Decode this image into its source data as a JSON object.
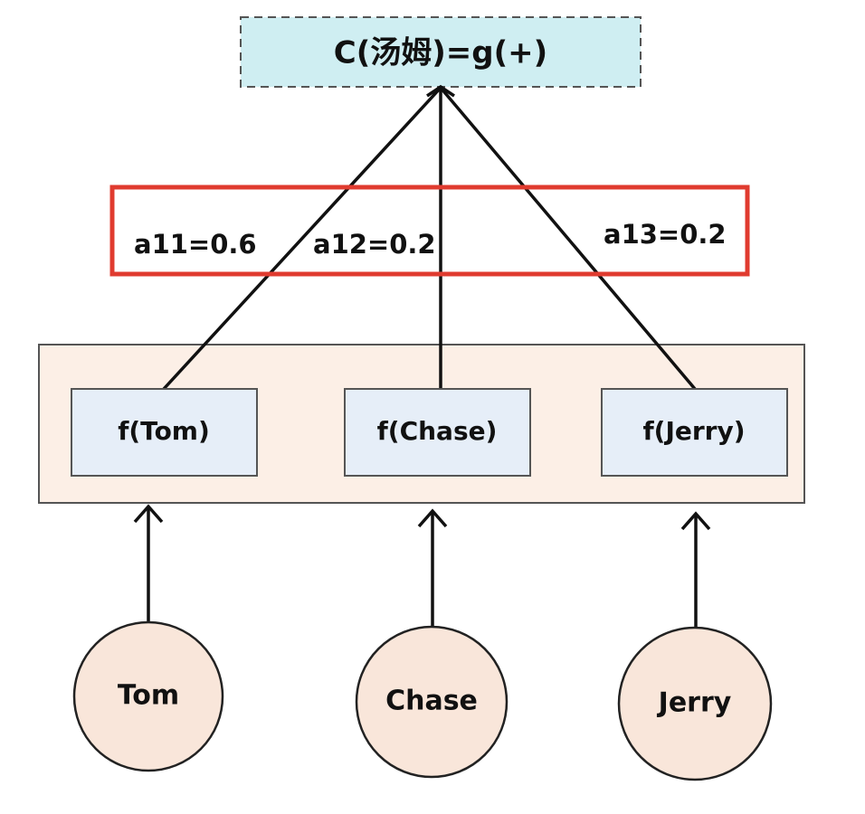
{
  "output_node": {
    "label": "C(汤姆)=g(+)",
    "fill": "#cfeef2",
    "stroke": "#555555"
  },
  "weights": [
    {
      "label": "a11=0.6"
    },
    {
      "label": "a12=0.2"
    },
    {
      "label": "a13=0.2"
    }
  ],
  "weights_highlight_color": "#e03b2f",
  "encoder_group": {
    "fill": "#fcefe6"
  },
  "encoders": [
    {
      "label": "f(Tom)"
    },
    {
      "label": "f(Chase)"
    },
    {
      "label": "f(Jerry)"
    }
  ],
  "encoder_fill": "#e6eef8",
  "inputs": [
    {
      "label": "Tom"
    },
    {
      "label": "Chase"
    },
    {
      "label": "Jerry"
    }
  ],
  "input_fill": "#f9e6da"
}
